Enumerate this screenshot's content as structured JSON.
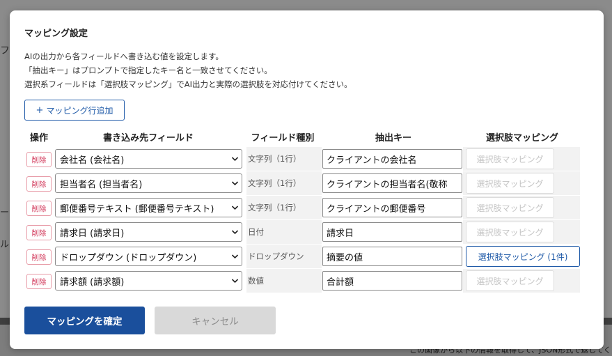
{
  "background": {
    "fragments": [
      "フ",
      "ー",
      "ル"
    ],
    "bottom_text": "この画像から以下の情報を取得して、JSON形式で返してく"
  },
  "modal": {
    "title": "マッピング設定",
    "description": [
      "AIの出力から各フィールドへ書き込む値を設定します。",
      "「抽出キー」はプロンプトで指定したキー名と一致させてください。",
      "選択系フィールドは「選択肢マッピング」でAI出力と実際の選択肢を対応付けてください。"
    ],
    "add_row_label": "マッピング行追加",
    "add_row_icon": "plus-icon",
    "headers": {
      "operation": "操作",
      "target_field": "書き込み先フィールド",
      "field_type": "フィールド種別",
      "extract_key": "抽出キー",
      "choice_mapping": "選択肢マッピング"
    },
    "rows": [
      {
        "delete": "削除",
        "field": "会社名 (会社名)",
        "type": "文字列（1行）",
        "key": "クライアントの会社名",
        "mapping": "選択肢マッピング",
        "mapping_enabled": false
      },
      {
        "delete": "削除",
        "field": "担当者名 (担当者名)",
        "type": "文字列（1行）",
        "key": "クライアントの担当者名(敬称",
        "mapping": "選択肢マッピング",
        "mapping_enabled": false
      },
      {
        "delete": "削除",
        "field": "郵便番号テキスト (郵便番号テキスト)",
        "type": "文字列（1行）",
        "key": "クライアントの郵便番号",
        "mapping": "選択肢マッピング",
        "mapping_enabled": false
      },
      {
        "delete": "削除",
        "field": "請求日 (請求日)",
        "type": "日付",
        "key": "請求日",
        "mapping": "選択肢マッピング",
        "mapping_enabled": false
      },
      {
        "delete": "削除",
        "field": "ドロップダウン (ドロップダウン)",
        "type": "ドロップダウン",
        "key": "摘要の値",
        "mapping": "選択肢マッピング (1件)",
        "mapping_enabled": true
      },
      {
        "delete": "削除",
        "field": "請求額 (請求額)",
        "type": "数値",
        "key": "合計額",
        "mapping": "選択肢マッピング",
        "mapping_enabled": false
      }
    ],
    "confirm_label": "マッピングを確定",
    "cancel_label": "キャンセル"
  },
  "colors": {
    "primary": "#1a4f9c",
    "delete": "#d2385a",
    "disabled_button": "#d9d9d9"
  }
}
